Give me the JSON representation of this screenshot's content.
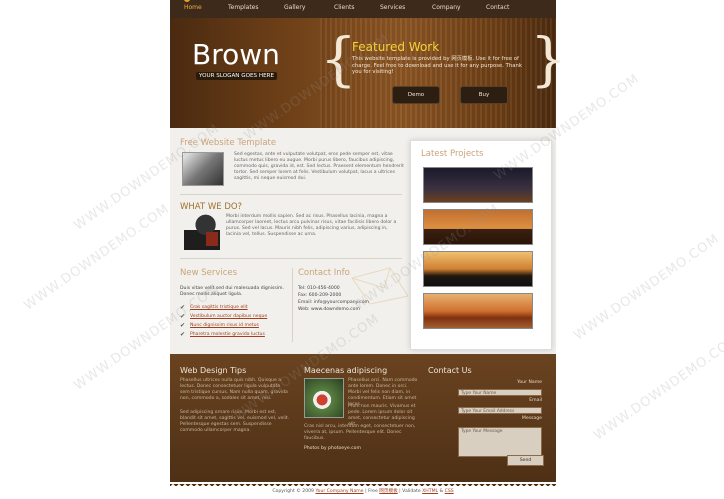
{
  "nav": {
    "items": [
      "Home",
      "Templates",
      "Gallery",
      "Clients",
      "Services",
      "Company",
      "Contact"
    ]
  },
  "header": {
    "logo": "Brown",
    "slogan": "YOUR SLOGAN GOES HERE",
    "featured_title": "Featured Work",
    "featured_text": "This website template is provided by 网页模板. Use it for free of charge. Feel free to download and use it for any purpose. Thank you for visiting!",
    "demo_button": "Demo",
    "buy_button": "Buy"
  },
  "main": {
    "free_title": "Free Website Template",
    "free_text": "Sed egestas, ante et vulputate volutpat, eros pede semper est, vitae luctus metus libero eu augue. Morbi purus libero, faucibus adipiscing, commodo quis, gravida id, est. Sed lectus. Praesent elementum hendrerit tortor. Sed semper lorem at felis. Vestibulum volutpat, lacus a ultrices sagittis, mi neque euismod dui.",
    "what_title": "WHAT WE DO?",
    "what_text": "Morbi interdum mollis sapien. Sed ac risus. Phasellus lacinia, magna a ullamcorper laoreet, lectus arcu pulvinar risus, vitae facilisis libero dolor a purus. Sed vel lacus. Mauris nibh felis, adipiscing varius, adipiscing in, lacinia vel, tellus. Suspendisse ac urna.",
    "services_title": "New Services",
    "services_text": "Duis vitae velit sed dui malesuada dignissim. Donec mollis aliquet ligula.",
    "services": [
      "Cras sagittis tristique elit",
      "Vestibulum auctor dapibus neque",
      "Nunc dignissim risus id metus",
      "Pharetra molestie gravida luctus"
    ],
    "contact_title": "Contact Info",
    "contact_lines": [
      "Tel: 010-456-4000",
      "Fax: 600-209-2000",
      "Email: info@yourcompany.com",
      "Web: www.downdemo.com"
    ],
    "latest_title": "Latest Projects"
  },
  "footer": {
    "tips_title": "Web Design Tips",
    "tips_text1": "Phasellus ultrices nulla quis nibh. Quisque a lectus. Donec consectetuer ligula vulputate sem tristique cursus. Nam nulla quam, gravida non, commodo a, sodales sit amet, nisi.",
    "tips_text2": "Sed adipiscing ornare risus. Morbi est est, blandit sit amet, sagittis vel, euismod vel, velit. Pellentesque egestas sem. Suspendisse commodo ullamcorper magna.",
    "maecenas_title": "Maecenas adipiscing",
    "maecenas_side": "Phasellus orci. Nam commodo ante lorem. Donec in orci. Morbi vel felis non diam, in condimentum. Etiam sit amet lacus.",
    "maecenas_side2": "Proin non mauris. Vivamus et pede. Lorem ipsum dolor sit amet, consectetur adipiscing elit.",
    "maecenas_text": "Cras nisl arcu, interdum eget, consectetuer non, viverra at, ipsum. Pellentesque elit. Donec faucibus.",
    "photos_by": "Photos by photoeye.com",
    "contact_title": "Contact Us",
    "label_name": "Your Name",
    "label_email": "Email",
    "label_message": "Message",
    "name_placeholder": "Type Your Name",
    "email_placeholder": "Type Your Email Address",
    "message_placeholder": "Type Your Message",
    "send_button": "Send",
    "copyright_prefix": "Copyright © 2009",
    "company_link": "Your Company Name",
    "copyright_mid": "| Free",
    "freebie_link": "网页模板",
    "copyright_valid": "| Validate",
    "xhtml_link": "XHTML",
    "css_link": "CSS",
    "amp": "&"
  },
  "watermark": "WWW.DOWNDEMO.COM"
}
